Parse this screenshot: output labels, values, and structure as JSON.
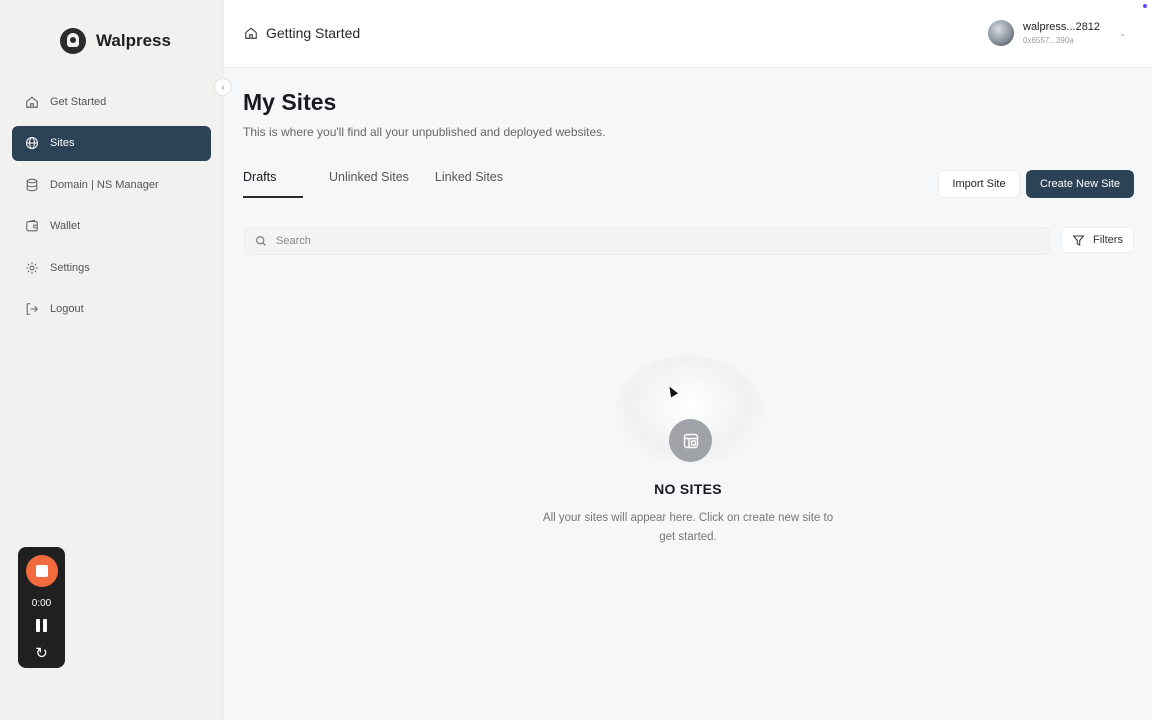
{
  "brand": {
    "name": "Walpress"
  },
  "sidebar": {
    "items": [
      {
        "label": "Get Started",
        "icon": "home-icon",
        "active": false
      },
      {
        "label": "Sites",
        "icon": "globe-icon",
        "active": true
      },
      {
        "label": "Domain | NS Manager",
        "icon": "database-icon",
        "active": false
      },
      {
        "label": "Wallet",
        "icon": "wallet-icon",
        "active": false
      },
      {
        "label": "Settings",
        "icon": "gear-icon",
        "active": false
      },
      {
        "label": "Logout",
        "icon": "logout-icon",
        "active": false
      }
    ]
  },
  "recorder": {
    "time": "0:00"
  },
  "header": {
    "breadcrumb": "Getting Started",
    "account_name": "walpress...2812",
    "account_address": "0x6557...390a"
  },
  "main": {
    "title": "My Sites",
    "subtitle": "This is where you'll find all your unpublished and deployed websites.",
    "tabs": [
      {
        "label": "Drafts",
        "active": true
      },
      {
        "label": "Unlinked Sites",
        "active": false
      },
      {
        "label": "Linked Sites",
        "active": false
      }
    ],
    "import_label": "Import Site",
    "create_label": "Create New Site",
    "search_placeholder": "Search",
    "filters_label": "Filters",
    "empty_title": "NO SITES",
    "empty_desc": "All your sites will appear here. Click on create new site to get started."
  },
  "colors": {
    "accent": "#2b4257",
    "recorder_stop": "#f26a3d"
  }
}
